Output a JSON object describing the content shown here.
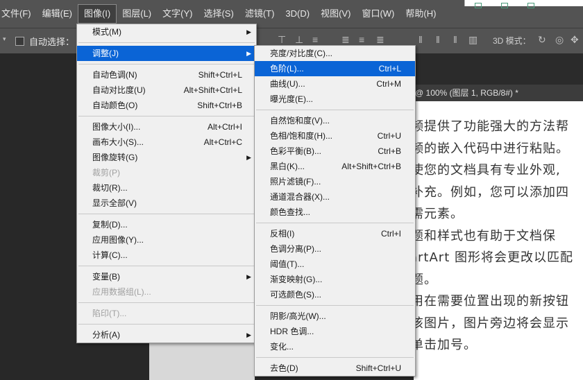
{
  "menubar": {
    "items": [
      "文件(F)",
      "编辑(E)",
      "图像(I)",
      "图层(L)",
      "文字(Y)",
      "选择(S)",
      "滤镜(T)",
      "3D(D)",
      "视图(V)",
      "窗口(W)",
      "帮助(H)"
    ]
  },
  "options": {
    "auto_select": "自动选择：",
    "mode_3d": "3D 模式："
  },
  "document": {
    "tab_title": "@ 100% (图层 1, RGB/8#) *",
    "lines": [
      "频提供了功能强大的方法帮",
      "频的嵌入代码中进行粘贴。",
      "使您的文档具有专业外观,",
      "补充。例如，您可以添加四",
      "需元素。",
      "题和样式也有助于文档保",
      "artArt 图形将会更改以匹配",
      "题。",
      "用在需要位置出现的新按钮",
      "该图片，图片旁边将会显示",
      "单击加号。"
    ]
  },
  "image_menu": {
    "items": [
      {
        "label": "模式(M)",
        "shortcut": "",
        "submenu": true
      },
      {
        "sep": true
      },
      {
        "label": "调整(J)",
        "shortcut": "",
        "submenu": true,
        "highlighted": true
      },
      {
        "sep": true
      },
      {
        "label": "自动色调(N)",
        "shortcut": "Shift+Ctrl+L"
      },
      {
        "label": "自动对比度(U)",
        "shortcut": "Alt+Shift+Ctrl+L"
      },
      {
        "label": "自动颜色(O)",
        "shortcut": "Shift+Ctrl+B"
      },
      {
        "sep": true
      },
      {
        "label": "图像大小(I)...",
        "shortcut": "Alt+Ctrl+I"
      },
      {
        "label": "画布大小(S)...",
        "shortcut": "Alt+Ctrl+C"
      },
      {
        "label": "图像旋转(G)",
        "shortcut": "",
        "submenu": true
      },
      {
        "label": "裁剪(P)",
        "shortcut": "",
        "disabled": true
      },
      {
        "label": "裁切(R)...",
        "shortcut": ""
      },
      {
        "label": "显示全部(V)",
        "shortcut": ""
      },
      {
        "sep": true
      },
      {
        "label": "复制(D)...",
        "shortcut": ""
      },
      {
        "label": "应用图像(Y)...",
        "shortcut": ""
      },
      {
        "label": "计算(C)...",
        "shortcut": ""
      },
      {
        "sep": true
      },
      {
        "label": "变量(B)",
        "shortcut": "",
        "submenu": true
      },
      {
        "label": "应用数据组(L)...",
        "shortcut": "",
        "disabled": true
      },
      {
        "sep": true
      },
      {
        "label": "陷印(T)...",
        "shortcut": "",
        "disabled": true
      },
      {
        "sep": true
      },
      {
        "label": "分析(A)",
        "shortcut": "",
        "submenu": true
      }
    ]
  },
  "adjust_menu": {
    "items": [
      {
        "label": "亮度/对比度(C)...",
        "shortcut": ""
      },
      {
        "label": "色阶(L)...",
        "shortcut": "Ctrl+L",
        "highlighted": true
      },
      {
        "label": "曲线(U)...",
        "shortcut": "Ctrl+M"
      },
      {
        "label": "曝光度(E)...",
        "shortcut": ""
      },
      {
        "sep": true
      },
      {
        "label": "自然饱和度(V)...",
        "shortcut": ""
      },
      {
        "label": "色相/饱和度(H)...",
        "shortcut": "Ctrl+U"
      },
      {
        "label": "色彩平衡(B)...",
        "shortcut": "Ctrl+B"
      },
      {
        "label": "黑白(K)...",
        "shortcut": "Alt+Shift+Ctrl+B"
      },
      {
        "label": "照片滤镜(F)...",
        "shortcut": ""
      },
      {
        "label": "通道混合器(X)...",
        "shortcut": ""
      },
      {
        "label": "颜色查找...",
        "shortcut": ""
      },
      {
        "sep": true
      },
      {
        "label": "反相(I)",
        "shortcut": "Ctrl+I"
      },
      {
        "label": "色调分离(P)...",
        "shortcut": ""
      },
      {
        "label": "阈值(T)...",
        "shortcut": ""
      },
      {
        "label": "渐变映射(G)...",
        "shortcut": ""
      },
      {
        "label": "可选颜色(S)...",
        "shortcut": ""
      },
      {
        "sep": true
      },
      {
        "label": "阴影/高光(W)...",
        "shortcut": ""
      },
      {
        "label": "HDR 色调...",
        "shortcut": ""
      },
      {
        "label": "变化...",
        "shortcut": ""
      },
      {
        "sep": true
      },
      {
        "label": "去色(D)",
        "shortcut": "Shift+Ctrl+U"
      }
    ]
  },
  "colors": {
    "highlight": "#0a64d6",
    "menu_bg": "#f0f0f0",
    "chrome": "#535353"
  }
}
